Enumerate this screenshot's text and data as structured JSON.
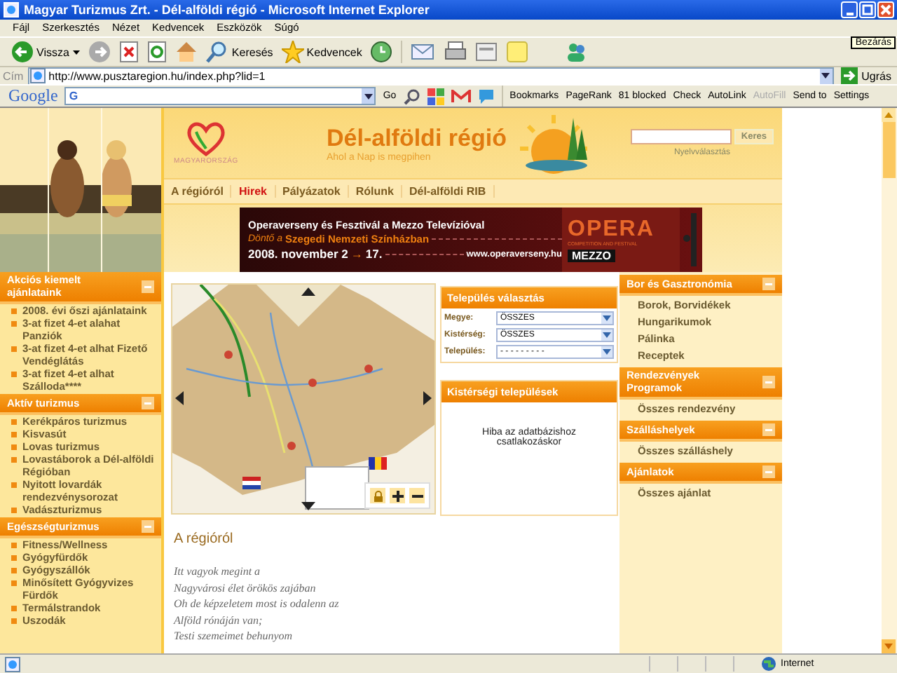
{
  "window": {
    "title": "Magyar Turizmus Zrt. - Dél-alföldi régió - Microsoft Internet Explorer",
    "tooltip": "Bezárás"
  },
  "menu": [
    "Fájl",
    "Szerkesztés",
    "Nézet",
    "Kedvencek",
    "Eszközök",
    "Súgó"
  ],
  "toolbar": {
    "back": "Vissza",
    "search": "Keresés",
    "favorites": "Kedvencek"
  },
  "address": {
    "label": "Cím",
    "url": "http://www.pusztaregion.hu/index.php?lid=1",
    "go": "Ugrás"
  },
  "google_toolbar": {
    "logo": "Google",
    "search_prefix": "G",
    "go": "Go",
    "items": [
      {
        "label": "Bookmarks",
        "disabled": false
      },
      {
        "label": "PageRank",
        "disabled": false
      },
      {
        "label": "81 blocked",
        "disabled": false
      },
      {
        "label": "Check",
        "disabled": false
      },
      {
        "label": "AutoLink",
        "disabled": false
      },
      {
        "label": "AutoFill",
        "disabled": true
      },
      {
        "label": "Send to",
        "disabled": false
      },
      {
        "label": "Settings",
        "disabled": false
      }
    ]
  },
  "header": {
    "logo_text": "MAGYARORSZÁG",
    "title": "Dél-alföldi régió",
    "subtitle": "Ahol a Nap is megpihen",
    "search_button": "Keres",
    "language": "Nyelvválasztás"
  },
  "nav": [
    {
      "label": "A régióról",
      "selected": false
    },
    {
      "label": "Hirek",
      "selected": true
    },
    {
      "label": "Pályázatok",
      "selected": false
    },
    {
      "label": "Rólunk",
      "selected": false
    },
    {
      "label": "Dél-alföldi RIB",
      "selected": false
    }
  ],
  "banner": {
    "line1": "Operaverseny és Fesztivál a Mezzo Televízióval",
    "line2_prefix": "Döntő a",
    "line2": "Szegedi Nemzeti Színházban",
    "date_start": "2008. november 2",
    "arrow": "→",
    "date_end": "17.",
    "url": "www.operaverseny.hu",
    "logo": "OPERA",
    "logo_sub": "COMPETITION AND FESTIVAL",
    "channel": "MEZZO"
  },
  "left_sidebar": [
    {
      "title": "Akciós kiemelt ajánlataink",
      "expanded": true,
      "items": [
        "2008. évi őszi ajánlataink",
        "3-at fizet 4-et alahat Panziók",
        "3-at fizet 4-et alhat Fizető Vendéglátás",
        "3-at fizet 4-et alhat Szálloda****"
      ]
    },
    {
      "title": "Aktív turizmus",
      "expanded": true,
      "items": [
        "Kerékpáros turizmus",
        "Kisvasút",
        "Lovas turizmus",
        "Lovastáborok a Dél-alföldi Régióban",
        "Nyitott lovardák rendezvénysorozat",
        "Vadászturizmus"
      ]
    },
    {
      "title": "Egészségturizmus",
      "expanded": true,
      "items": [
        "Fitness/Wellness",
        "Gyógyfürdők",
        "Gyógyszállók",
        "Minősített Gyógyvizes Fürdők",
        "Termálstrandok",
        "Uszodák"
      ]
    }
  ],
  "settlement_select": {
    "title": "Település választás",
    "fields": [
      {
        "label": "Megye:",
        "value": "ÖSSZES"
      },
      {
        "label": "Kistérség:",
        "value": "ÖSSZES"
      },
      {
        "label": "Település:",
        "value": "- - - - - - - - -"
      }
    ]
  },
  "subregion_box": {
    "title": "Kistérségi települések",
    "message": "Hiba az adatbázishoz csatlakozáskor"
  },
  "article": {
    "heading": "A régióról",
    "lines": [
      "Itt vagyok megint a",
      "Nagyvárosi élet örökös zajában",
      "Oh de képzeletem most is odalenn az",
      "Alföld rónáján van;",
      "Testi szemeimet behunyom"
    ]
  },
  "right_sidebar": [
    {
      "title": "Bor és Gasztronómia",
      "expanded": true,
      "items": [
        "Borok, Borvidékek",
        "Hungarikumok",
        "Pálinka",
        "Receptek"
      ]
    },
    {
      "title": "Rendezvények Programok",
      "expanded": true,
      "items": [
        "Összes rendezvény"
      ]
    },
    {
      "title": "Szálláshelyek",
      "expanded": true,
      "items": [
        "Összes szálláshely"
      ]
    },
    {
      "title": "Ajánlatok",
      "expanded": true,
      "items": [
        "Összes ajánlat"
      ]
    }
  ],
  "status_bar": {
    "zone": "Internet"
  }
}
